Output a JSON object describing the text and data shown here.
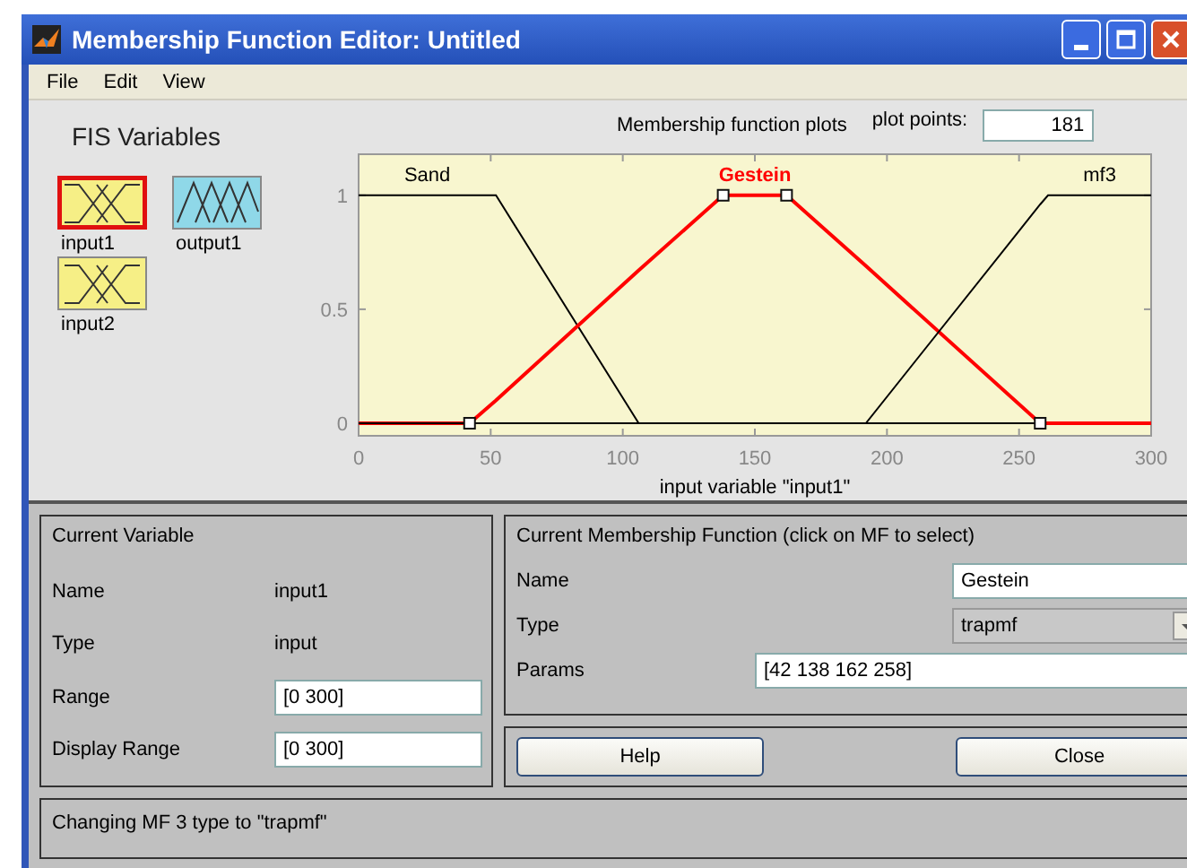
{
  "window": {
    "title": "Membership Function Editor: Untitled"
  },
  "menu": [
    "File",
    "Edit",
    "View"
  ],
  "fis_variables": {
    "title": "FIS Variables",
    "items": [
      {
        "label": "input1",
        "kind": "input",
        "selected": true
      },
      {
        "label": "output1",
        "kind": "output",
        "selected": false
      },
      {
        "label": "input2",
        "kind": "input",
        "selected": false
      }
    ]
  },
  "plot": {
    "plot_points_label": "plot points:",
    "plot_points": "181",
    "chart_data": {
      "type": "line",
      "title": "Membership function plots",
      "xlabel": "input variable \"input1\"",
      "x": [
        0,
        42,
        52,
        106,
        138,
        162,
        192,
        258,
        261,
        300
      ],
      "series": [
        {
          "name": "Sand",
          "color": "#000000",
          "values": [
            1,
            1,
            1,
            0,
            0,
            0,
            0,
            0,
            0,
            0
          ]
        },
        {
          "name": "Gestein",
          "color": "#ff0000",
          "values": [
            0,
            0,
            0.1,
            0.67,
            1,
            1,
            0.69,
            0,
            0,
            0
          ]
        },
        {
          "name": "mf3",
          "color": "#000000",
          "values": [
            0,
            0,
            0,
            0,
            0,
            0,
            0,
            0.96,
            1,
            1
          ]
        }
      ],
      "xlim": [
        0,
        300
      ],
      "ylim": [
        -0.055,
        1.18
      ],
      "xticks": [
        0,
        50,
        100,
        150,
        200,
        250,
        300
      ],
      "yticks": [
        0,
        0.5,
        1
      ]
    }
  },
  "current_variable": {
    "title": "Current Variable",
    "fields": [
      {
        "label": "Name",
        "value": "input1",
        "kind": "text"
      },
      {
        "label": "Type",
        "value": "input",
        "kind": "text"
      },
      {
        "label": "Range",
        "value": "[0 300]",
        "kind": "input"
      },
      {
        "label": "Display Range",
        "value": "[0 300]",
        "kind": "input"
      }
    ]
  },
  "current_mf": {
    "title": "Current Membership Function (click on MF to select)",
    "name_label": "Name",
    "name": "Gestein",
    "type_label": "Type",
    "type": "trapmf",
    "params_label": "Params",
    "params": "[42 138 162 258]"
  },
  "buttons": [
    "Help",
    "Close"
  ],
  "status": "Changing MF 3 type to \"trapmf\""
}
